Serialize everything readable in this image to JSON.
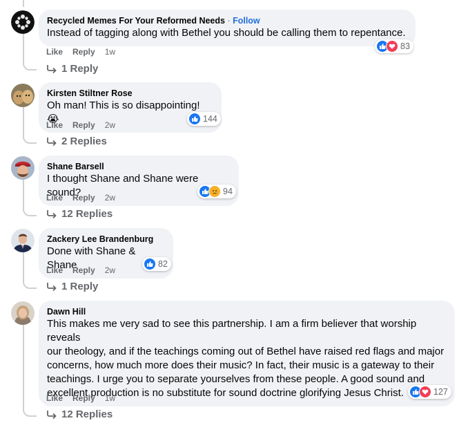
{
  "comments": [
    {
      "author": "Recycled Memes For Your Reformed Needs",
      "follow": "Follow",
      "text": "Instead of tagging along with Bethel you should be calling them to repentance.",
      "actions": {
        "like": "Like",
        "reply": "Reply",
        "time": "1w"
      },
      "reactions": {
        "icons": [
          "like-icon",
          "love-icon"
        ],
        "count": "83"
      },
      "replies": "1 Reply"
    },
    {
      "author": "Kirsten Stiltner Rose",
      "text": "Oh man! This is so disappointing! 😭",
      "actions": {
        "like": "Like",
        "reply": "Reply",
        "time": "2w"
      },
      "reactions": {
        "icons": [
          "like-icon"
        ],
        "count": "144"
      },
      "replies": "2 Replies"
    },
    {
      "author": "Shane Barsell",
      "text": "I thought Shane and Shane were sound?",
      "actions": {
        "like": "Like",
        "reply": "Reply",
        "time": "2w"
      },
      "reactions": {
        "icons": [
          "like-icon",
          "sad-icon"
        ],
        "count": "94"
      },
      "replies": "12 Replies"
    },
    {
      "author": "Zackery Lee Brandenburg",
      "text": "Done with Shane & Shane",
      "actions": {
        "like": "Like",
        "reply": "Reply",
        "time": "2w"
      },
      "reactions": {
        "icons": [
          "like-icon"
        ],
        "count": "82"
      },
      "replies": "1 Reply"
    },
    {
      "author": "Dawn Hill",
      "text_lines": [
        "This makes me very sad to see this partnership. I am a firm believer that worship reveals",
        "our theology, and if the teachings coming out of Bethel have raised red flags and major",
        "concerns, how much more does their music? In fact, their music is a gateway to their",
        "teachings. I urge you to separate yourselves from these people. A good sound and",
        "excellent production is no substitute for sound doctrine glorifying Jesus Christ."
      ],
      "actions": {
        "like": "Like",
        "reply": "Reply",
        "time": "1w"
      },
      "reactions": {
        "icons": [
          "like-icon",
          "love-icon"
        ],
        "count": "127"
      },
      "replies": "12 Replies"
    }
  ],
  "colors": {
    "accent": "#216fdb",
    "bubble": "#f0f2f5",
    "like": "#1877f2",
    "love": "#f33e58",
    "muted": "#65676b"
  }
}
